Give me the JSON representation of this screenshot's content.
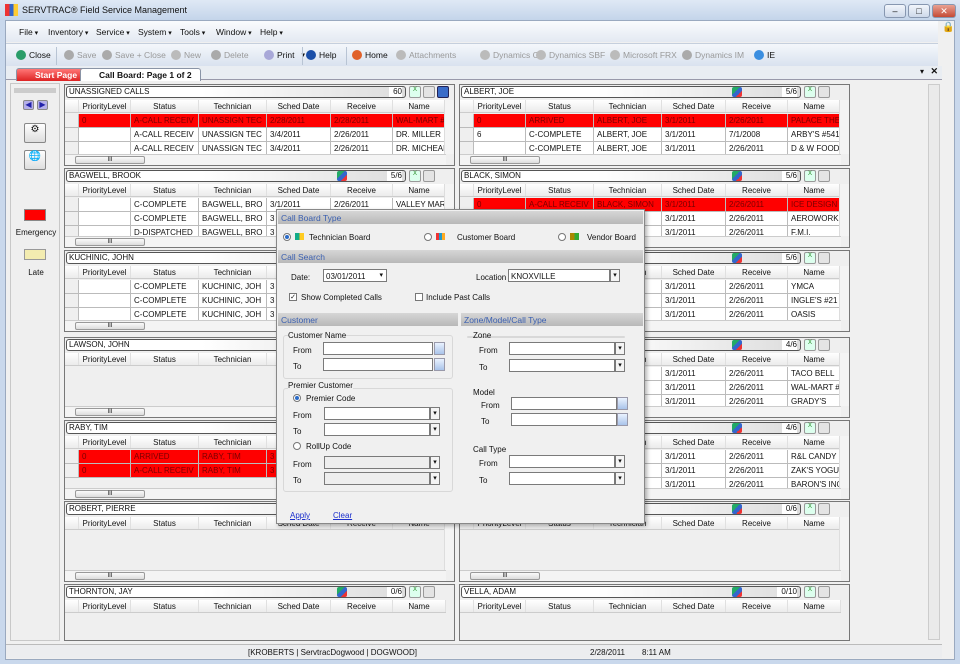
{
  "window": {
    "title": "SERVTRAC® Field Service Management"
  },
  "menu": [
    "File",
    "Inventory",
    "Service",
    "System",
    "Tools",
    "Window",
    "Help"
  ],
  "toolbar": [
    {
      "label": "Close",
      "enabled": true,
      "icon": "close-circle-icon"
    },
    {
      "label": "Save",
      "enabled": false,
      "icon": "save-icon"
    },
    {
      "label": "Save + Close",
      "enabled": false,
      "icon": "save-close-icon"
    },
    {
      "label": "New",
      "enabled": false,
      "icon": "new-doc-icon"
    },
    {
      "label": "Delete",
      "enabled": false,
      "icon": "delete-icon"
    },
    {
      "label": "Print",
      "enabled": true,
      "icon": "print-icon",
      "dropdown": true
    },
    {
      "label": "Help",
      "enabled": true,
      "icon": "help-icon"
    },
    {
      "label": "Home",
      "enabled": true,
      "icon": "home-icon"
    },
    {
      "label": "Attachments",
      "enabled": false,
      "icon": "attachment-icon"
    },
    {
      "label": "Dynamics GP",
      "enabled": false,
      "icon": "dynamics-gp-icon"
    },
    {
      "label": "Dynamics SBF",
      "enabled": false,
      "icon": "dynamics-sbf-icon"
    },
    {
      "label": "Microsoft FRX",
      "enabled": false,
      "icon": "frx-icon"
    },
    {
      "label": "Dynamics IM",
      "enabled": false,
      "icon": "dynamics-im-icon"
    },
    {
      "label": "IE",
      "enabled": true,
      "icon": "ie-icon"
    }
  ],
  "tabs": [
    {
      "label": "Start Page",
      "active": false
    },
    {
      "label": "Call Board: Page 1 of 2",
      "active": true
    }
  ],
  "legend": {
    "emergency": {
      "label": "Emergency",
      "color": "#ff0000"
    },
    "late": {
      "label": "Late",
      "color": "#f3ecb0"
    }
  },
  "columns": [
    "PriorityLevel",
    "Status",
    "Technician",
    "Sched Date",
    "Receive",
    "Name"
  ],
  "boards_left": [
    {
      "name": "UNASSIGNED CALLS",
      "count": "60",
      "rows": [
        {
          "emergency": true,
          "cells": [
            "0",
            "A-CALL RECEIV",
            "UNASSIGN TEC",
            "2/28/2011",
            "2/28/2011",
            "WAL-MART #"
          ]
        },
        {
          "emergency": false,
          "cells": [
            "",
            "A-CALL RECEIV",
            "UNASSIGN TEC",
            "3/4/2011",
            "2/26/2011",
            "DR. MILLER"
          ]
        },
        {
          "emergency": false,
          "cells": [
            "",
            "A-CALL RECEIV",
            "UNASSIGN TEC",
            "3/4/2011",
            "2/26/2011",
            "DR. MICHEAL"
          ]
        }
      ]
    },
    {
      "name": "BAGWELL, BROOK",
      "count": "5/6",
      "rows": [
        {
          "emergency": false,
          "cells": [
            "",
            "C-COMPLETE",
            "BAGWELL, BRO",
            "3/1/2011",
            "2/26/2011",
            "VALLEY MAR"
          ]
        },
        {
          "emergency": false,
          "cells": [
            "",
            "C-COMPLETE",
            "BAGWELL, BRO",
            "3",
            "",
            ""
          ]
        },
        {
          "emergency": false,
          "cells": [
            "",
            "D-DISPATCHED",
            "BAGWELL, BRO",
            "3",
            "",
            ""
          ]
        }
      ]
    },
    {
      "name": "KUCHINIC, JOHN",
      "count": "",
      "rows": [
        {
          "emergency": false,
          "cells": [
            "",
            "C-COMPLETE",
            "KUCHINIC, JOH",
            "3",
            "",
            ""
          ]
        },
        {
          "emergency": false,
          "cells": [
            "",
            "C-COMPLETE",
            "KUCHINIC, JOH",
            "3",
            "",
            ""
          ]
        },
        {
          "emergency": false,
          "cells": [
            "",
            "C-COMPLETE",
            "KUCHINIC, JOH",
            "3",
            "",
            ""
          ]
        }
      ]
    },
    {
      "name": "LAWSON, JOHN",
      "count": "",
      "rows": []
    },
    {
      "name": "RABY, TIM",
      "count": "",
      "rows": [
        {
          "emergency": true,
          "cells": [
            "0",
            "ARRIVED",
            "RABY, TIM",
            "3",
            "",
            ""
          ]
        },
        {
          "emergency": true,
          "cells": [
            "0",
            "A-CALL RECEIV",
            "RABY, TIM",
            "3",
            "",
            ""
          ]
        }
      ]
    },
    {
      "name": "ROBERT, PIERRE",
      "count": "",
      "rows": []
    },
    {
      "name": "THORNTON, JAY",
      "count": "0/6",
      "rows": []
    }
  ],
  "boards_right": [
    {
      "name": "ALBERT, JOE",
      "count": "5/6",
      "rows": [
        {
          "emergency": true,
          "cells": [
            "0",
            "ARRIVED",
            "ALBERT, JOE",
            "3/1/2011",
            "2/26/2011",
            "PALACE THE"
          ]
        },
        {
          "emergency": false,
          "cells": [
            "6",
            "C-COMPLETE",
            "ALBERT, JOE",
            "3/1/2011",
            "7/1/2008",
            "ARBY'S #541"
          ]
        },
        {
          "emergency": false,
          "cells": [
            "",
            "C-COMPLETE",
            "ALBERT, JOE",
            "3/1/2011",
            "2/26/2011",
            "D & W FOOD"
          ]
        }
      ]
    },
    {
      "name": "BLACK, SIMON",
      "count": "5/6",
      "rows": [
        {
          "emergency": true,
          "cells": [
            "0",
            "A-CALL RECEIV",
            "BLACK, SIMON",
            "3/1/2011",
            "2/26/2011",
            "ICE DESIGN"
          ]
        },
        {
          "emergency": false,
          "cells": [
            "",
            "",
            "N",
            "3/1/2011",
            "2/26/2011",
            "AEROWORK"
          ]
        },
        {
          "emergency": false,
          "cells": [
            "",
            "",
            "N",
            "3/1/2011",
            "2/26/2011",
            "F.M.I."
          ]
        }
      ]
    },
    {
      "name": "",
      "count": "5/6",
      "rows": [
        {
          "emergency": false,
          "cells": [
            "",
            "",
            "D",
            "3/1/2011",
            "2/26/2011",
            "YMCA"
          ]
        },
        {
          "emergency": false,
          "cells": [
            "",
            "",
            "D",
            "3/1/2011",
            "2/26/2011",
            "INGLE'S #21"
          ]
        },
        {
          "emergency": false,
          "cells": [
            "",
            "",
            "D",
            "3/1/2011",
            "2/26/2011",
            "OASIS"
          ]
        }
      ]
    },
    {
      "name": "",
      "count": "4/6",
      "rows": [
        {
          "emergency": false,
          "cells": [
            "",
            "",
            "HT",
            "3/1/2011",
            "2/26/2011",
            "TACO BELL"
          ]
        },
        {
          "emergency": false,
          "cells": [
            "",
            "",
            "HT",
            "3/1/2011",
            "2/26/2011",
            "WAL-MART #"
          ]
        },
        {
          "emergency": false,
          "cells": [
            "",
            "",
            "HT",
            "3/1/2011",
            "2/26/2011",
            "GRADY'S"
          ]
        }
      ]
    },
    {
      "name": "",
      "count": "4/6",
      "rows": [
        {
          "emergency": false,
          "cells": [
            "",
            "",
            "MY",
            "3/1/2011",
            "2/26/2011",
            "R&L CANDY"
          ]
        },
        {
          "emergency": false,
          "cells": [
            "",
            "",
            "MY",
            "3/1/2011",
            "2/26/2011",
            "ZAK'S YOGU"
          ]
        },
        {
          "emergency": false,
          "cells": [
            "",
            "",
            "MY",
            "3/1/2011",
            "2/26/2011",
            "BARON'S INC"
          ]
        }
      ]
    },
    {
      "name": "",
      "count": "0/6",
      "rows": []
    },
    {
      "name": "VELLA, ADAM",
      "count": "0/10",
      "rows": []
    }
  ],
  "dialog": {
    "board_type": {
      "title": "Call Board Type",
      "options": [
        "Technician Board",
        "Customer Board",
        "Vendor Board"
      ],
      "selected": "Technician Board"
    },
    "call_search": {
      "title": "Call Search",
      "date_label": "Date:",
      "date_value": "03/01/2011",
      "location_label": "Location",
      "location_value": "KNOXVILLE",
      "show_completed_label": "Show Completed Calls",
      "show_completed": true,
      "include_past_label": "Include Past Calls",
      "include_past": false
    },
    "customer": {
      "title": "Customer",
      "name_group": "Customer Name",
      "premier_group": "Premier Customer",
      "premier_code": "Premier Code",
      "rollup_code": "RollUp Code",
      "selected": "Premier Code",
      "from": "From",
      "to": "To"
    },
    "zone": {
      "title": "Zone/Model/Call Type",
      "zone": "Zone",
      "model": "Model",
      "call_type": "Call Type",
      "from": "From",
      "to": "To"
    },
    "apply": "Apply",
    "clear": "Clear"
  },
  "status": {
    "session": "[KROBERTS | ServtracDogwood | DOGWOOD]",
    "date": "2/28/2011",
    "time": "8:11 AM"
  }
}
